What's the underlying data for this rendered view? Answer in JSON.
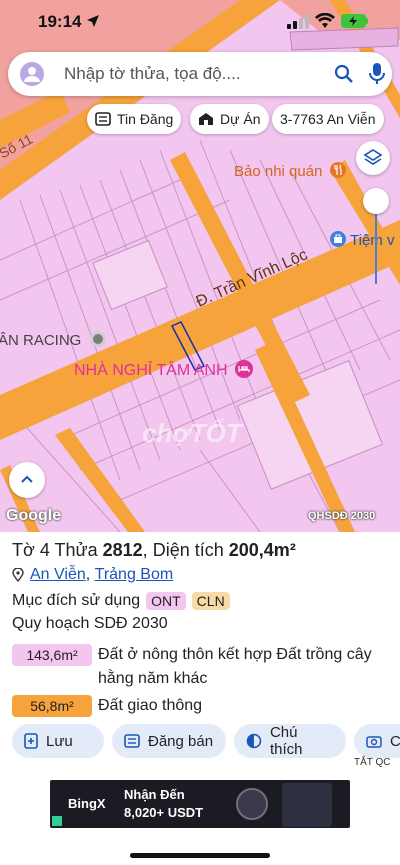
{
  "status_bar": {
    "time": "19:14"
  },
  "search": {
    "placeholder": "Nhập tờ thửa, tọa độ...."
  },
  "chips": {
    "listing": "Tin Đăng",
    "project": "Dự Án",
    "parcel": "3-7763 An Viễn"
  },
  "map_labels": {
    "restaurant": "Bảo nhi quán",
    "store": "Tiệm v",
    "road_main": "Đ. Trần Vĩnh Lộc",
    "road_side": "Số 11",
    "racing": "ÂN RACING",
    "hotel": "NHÀ NGHỈ TÂM ANH",
    "watermark": "chợTỐT",
    "google": "Google",
    "layer": "QHSDĐ 2030"
  },
  "parcel": {
    "title_prefix": "Tờ",
    "sheet": "4",
    "parcel_label": "Thửa",
    "parcel_no": "2812",
    "area_label": "Diện tích",
    "area": "200,4m²",
    "commune": "An Viễn",
    "district": "Trảng Bom",
    "purpose_label": "Mục đích sử dụng",
    "purpose_codes": [
      "ONT",
      "CLN"
    ],
    "plan_label": "Quy hoạch SDĐ 2030",
    "zones": [
      {
        "area": "143,6m²",
        "description": "Đất ở nông thôn kết hợp Đất trồng cây hằng năm khác",
        "color": "#f3c6ef"
      },
      {
        "area": "56,8m²",
        "description": "Đất giao thông",
        "color": "#f5a33a"
      }
    ]
  },
  "actions": {
    "save": "Lưu",
    "post": "Đăng bán",
    "note": "Chú thích",
    "more": "C"
  },
  "ad": {
    "label": "TẮT QC",
    "brand": "BingX",
    "headline": "Nhận Đến",
    "amount": "8,020+ USDT"
  },
  "colors": {
    "land_pink": "#f3c6ef",
    "road_orange": "#f5a33a",
    "salmon": "#f2a29e",
    "accent_blue": "#1a56b8",
    "hotel_pink": "#e0309a"
  }
}
